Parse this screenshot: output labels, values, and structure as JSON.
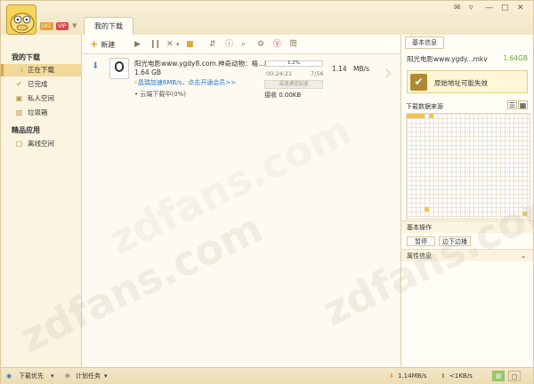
{
  "user": {
    "level": "LV1",
    "vip": "VIP"
  },
  "header": {
    "tab": "我的下载",
    "window_controls": [
      "✉",
      "▿",
      "—",
      "□",
      "✕"
    ]
  },
  "sidebar": {
    "title": "我的下载",
    "items": [
      {
        "label": "正在下载",
        "icon": "download-icon",
        "glyph": "⭳"
      },
      {
        "label": "已完成",
        "icon": "checkmark-icon",
        "glyph": "✔"
      },
      {
        "label": "私人空间",
        "icon": "lock-icon",
        "glyph": "▣"
      },
      {
        "label": "垃圾箱",
        "icon": "trash-icon",
        "glyph": "▥"
      }
    ],
    "apps_title": "精品应用",
    "apps": [
      {
        "label": "离线空间",
        "icon": "cloud-space-icon",
        "glyph": "□"
      }
    ]
  },
  "toolbar": {
    "new_label": "新建",
    "icons": [
      "play-icon",
      "pause-icon",
      "delete-icon",
      "dropdown-icon",
      "folder-icon",
      "sort-icon",
      "info-icon",
      "search-icon",
      "settings-icon",
      "vip-icon",
      "simplified-icon"
    ],
    "glyphs": [
      "▶",
      "❙❙",
      "✕",
      "▾",
      "■",
      "⇵",
      "ⓘ",
      "⌕",
      "⚙",
      "Ⓥ",
      "简"
    ]
  },
  "task": {
    "name": "阳光电影www.ygdy8.com.神奇动物：格...",
    "size": "1.64 GB",
    "accelerate_link": "晶瑞加速6MB/s，点击开通会员>>",
    "cloud_status": "云端下载中(0%)",
    "progress_text": "1.2%",
    "progress": 1.2,
    "elapsed": "00:24:21",
    "count": "7/56",
    "speed": "1.14",
    "speed_unit": "MB/s",
    "accel_button": "高速通道加速",
    "received": "接收 0.00KB"
  },
  "right_panel": {
    "tab": "基本信息",
    "file_name": "阳光电影www.ygdy...mkv",
    "file_size": "1.64GB",
    "notice": "原始地址可能失效",
    "source_title": "下载数据来源",
    "basic_ops": "基本操作",
    "pause_button": "暂停",
    "play_while_dl": "边下边播",
    "props": "属性信息"
  },
  "status": {
    "priority": "下载优先",
    "schedule": "计划任务",
    "down_speed": "1.14MB/s",
    "up_speed": "<1KB/s"
  },
  "watermark": "zdfans.com",
  "colors": {
    "accent": "#e3a631",
    "link": "#2a77c9",
    "success": "#65a82e"
  }
}
